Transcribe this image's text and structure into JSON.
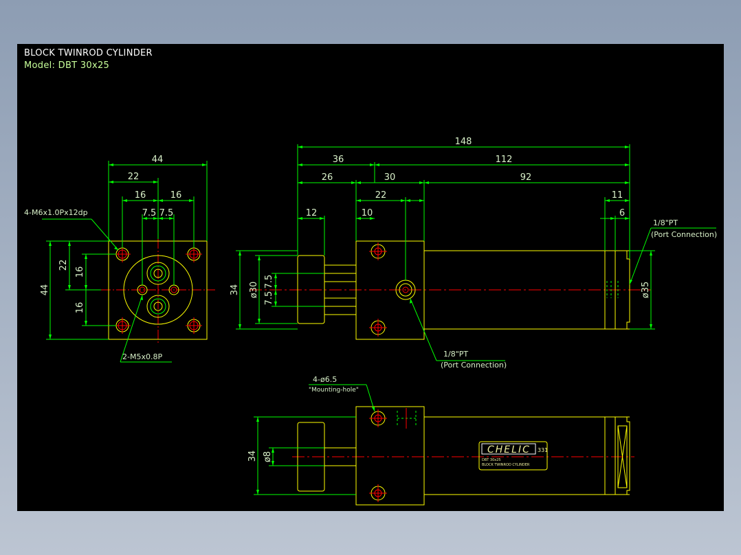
{
  "drawing": {
    "title": "BLOCK TWINROD CYLINDER",
    "model": "Model:  DBT 30x25"
  },
  "colors": {
    "background": "#000000",
    "outline": "#ffff00",
    "dimension": "#00ff00",
    "centerline": "#ff0000",
    "text": "#ffffff",
    "brand": "#f0f0a0"
  },
  "front_view": {
    "dims": {
      "width_overall": "44",
      "half_width": "22",
      "hole_pitch_left": "16",
      "hole_pitch_right": "16",
      "rod_pitch_left": "7.5",
      "rod_pitch_right": "7.5",
      "height_overall": "44",
      "half_height": "22",
      "hole_pitch_top": "16",
      "hole_pitch_bottom": "16"
    },
    "callouts": {
      "mounting_thread": "4-M6x1.0Px12dp",
      "port_thread": "2-M5x0.8P"
    }
  },
  "side_view": {
    "dims": {
      "overall_length": "148",
      "front_section": "36",
      "rear_section": "112",
      "plate_offset": "26",
      "block_length": "30",
      "tube_length": "92",
      "block_inner": "22",
      "plate_thickness": "12",
      "port_offset": "10",
      "end_cap": "11",
      "end_port": "6",
      "height": "34",
      "rod_plate_dia": "ø30",
      "rod_pitch_a": "7.5",
      "rod_pitch_b": "7.5",
      "tube_dia": "ø35"
    },
    "callouts": {
      "rear_port": "1/8\"PT",
      "rear_port_note": "(Port Connection)",
      "block_port": "1/8\"PT",
      "block_port_note": "(Port Connection)"
    }
  },
  "top_view": {
    "dims": {
      "height": "34",
      "rod_dia": "ø8"
    },
    "callouts": {
      "mounting_hole": "4-ø6.5",
      "mounting_hole_note": "\"Mounting-hole\""
    },
    "nameplate": {
      "brand": "CHELIC",
      "code": "331",
      "model": "DBT 30x25",
      "product": "BLOCK TWINROD CYLINDER"
    }
  }
}
